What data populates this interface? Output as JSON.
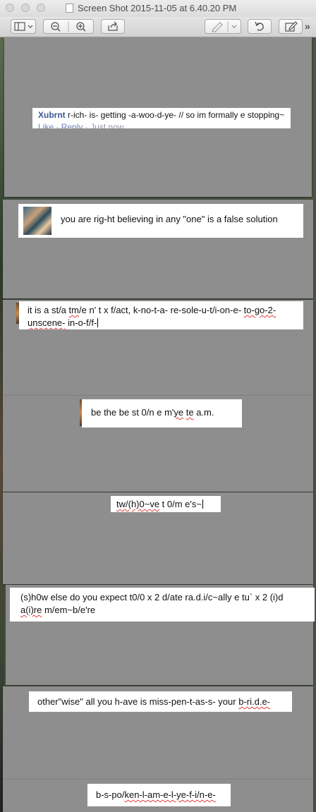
{
  "window": {
    "title": "Screen Shot 2015-11-05 at 6.40.20 PM"
  },
  "toolbar": {
    "icons": [
      "sidebar-icon",
      "zoom-out-icon",
      "zoom-in-icon",
      "share-icon",
      "markup-pen-icon",
      "rotate-icon",
      "edit-icon"
    ],
    "overflow": "»"
  },
  "posts": [
    {
      "author": "Xubrnt",
      "text": "r-ich- is- getting -a-woo-d-ye- // so im formally e stopping~",
      "actions": {
        "like": "Like",
        "separator": "·",
        "reply": "Reply",
        "separator2": "·",
        "time": "Just now"
      }
    },
    {
      "text": "you are rig-ht believing in any \"one\" is a false solution"
    },
    {
      "line1_a": "it is a st/a ",
      "line1_b": "tm",
      "line1_c": "/e n' t x f/act, k-no-t-a- re-sole-u-t/i-on-e- ",
      "line1_d": "to-go-2-",
      "line2_a": "unscene-",
      "line2_b": " in-o-f/f-"
    },
    {
      "a": "be the be st 0/n e m'",
      "b": "ye",
      "c": " ",
      "d": "te",
      "e": " a.m."
    },
    {
      "a": "tw/(h)0~ve",
      "b": " t 0/m e's~"
    },
    {
      "a": "(s)h0w else do you expect t0/0 x 2 d/ate ra.d.i/c~ally e tu` x 2 (i)d",
      "b": "a(i)re",
      "c": " m/em~b/e're"
    },
    {
      "a": "other\"wise\" all you h-ave is miss-pen-t-as-s- your ",
      "b": "b-ri.d.e-"
    },
    {
      "a": "b-s-po/",
      "b": "ken-l-am-e-l-ye-f-i/n-e-"
    }
  ]
}
